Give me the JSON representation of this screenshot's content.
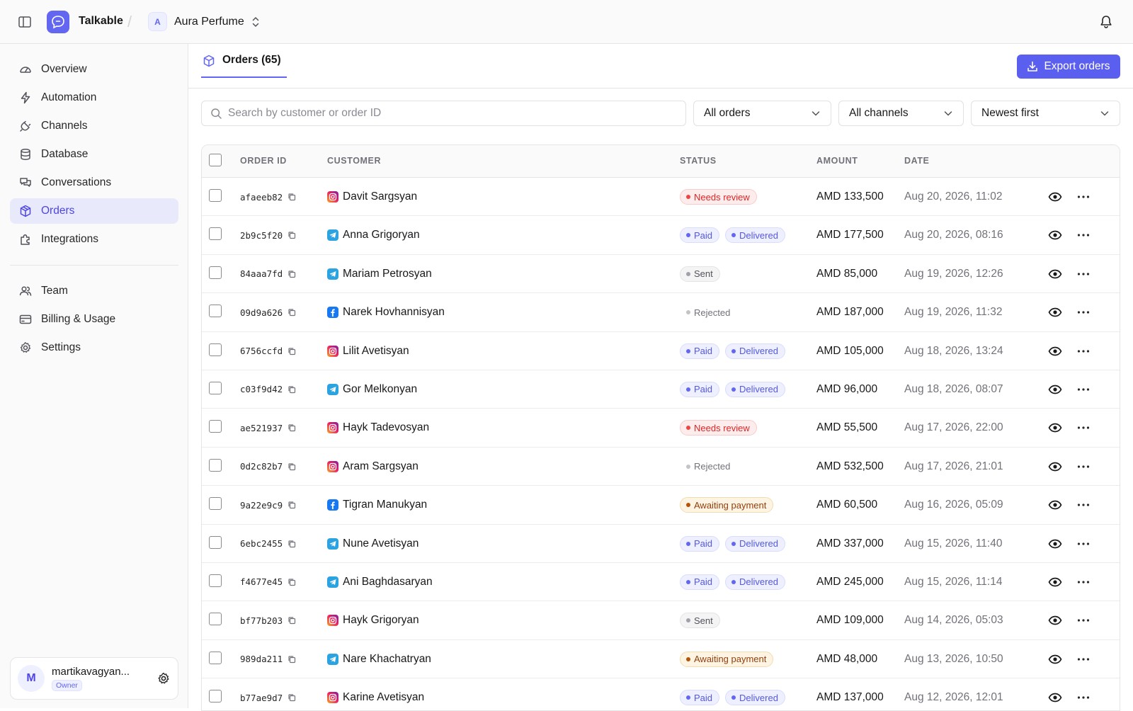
{
  "app": {
    "name": "Talkable",
    "logo_icon": "chat-link-icon"
  },
  "workspace": {
    "initial": "A",
    "name": "Aura Perfume"
  },
  "sidebar": {
    "items": [
      {
        "label": "Overview",
        "icon": "gauge-icon"
      },
      {
        "label": "Automation",
        "icon": "lightning-icon"
      },
      {
        "label": "Channels",
        "icon": "plug-icon"
      },
      {
        "label": "Database",
        "icon": "database-icon"
      },
      {
        "label": "Conversations",
        "icon": "chat-bubbles-icon"
      },
      {
        "label": "Orders",
        "icon": "package-icon",
        "active": true
      },
      {
        "label": "Integrations",
        "icon": "puzzle-icon"
      }
    ],
    "secondary": [
      {
        "label": "Team",
        "icon": "users-icon"
      },
      {
        "label": "Billing & Usage",
        "icon": "credit-card-icon"
      },
      {
        "label": "Settings",
        "icon": "gear-icon"
      }
    ],
    "user": {
      "initial": "M",
      "email": "martikavagyan...",
      "role": "Owner"
    }
  },
  "main": {
    "tab": {
      "label": "Orders (65)"
    },
    "export_label": "Export orders",
    "search": {
      "placeholder": "Search by customer or order ID",
      "value": ""
    },
    "filters": {
      "status": "All orders",
      "channel": "All channels",
      "sort": "Newest first"
    },
    "columns": [
      "ORDER ID",
      "CUSTOMER",
      "STATUS",
      "AMOUNT",
      "DATE"
    ],
    "orders": [
      {
        "id": "afaeeb82",
        "customer": "Davit Sargsyan",
        "channel": "instagram",
        "statuses": [
          {
            "label": "Needs review",
            "kind": "review"
          }
        ],
        "amount": "AMD 133,500",
        "date": "Aug 20, 2026, 11:02"
      },
      {
        "id": "2b9c5f20",
        "customer": "Anna Grigoryan",
        "channel": "telegram",
        "statuses": [
          {
            "label": "Paid",
            "kind": "paid"
          },
          {
            "label": "Delivered",
            "kind": "delivered"
          }
        ],
        "amount": "AMD 177,500",
        "date": "Aug 20, 2026, 08:16"
      },
      {
        "id": "84aaa7fd",
        "customer": "Mariam Petrosyan",
        "channel": "telegram",
        "statuses": [
          {
            "label": "Sent",
            "kind": "sent"
          }
        ],
        "amount": "AMD 85,000",
        "date": "Aug 19, 2026, 12:26"
      },
      {
        "id": "09d9a626",
        "customer": "Narek Hovhannisyan",
        "channel": "facebook",
        "statuses": [
          {
            "label": "Rejected",
            "kind": "rejected"
          }
        ],
        "amount": "AMD 187,000",
        "date": "Aug 19, 2026, 11:32"
      },
      {
        "id": "6756ccfd",
        "customer": "Lilit Avetisyan",
        "channel": "instagram",
        "statuses": [
          {
            "label": "Paid",
            "kind": "paid"
          },
          {
            "label": "Delivered",
            "kind": "delivered"
          }
        ],
        "amount": "AMD 105,000",
        "date": "Aug 18, 2026, 13:24"
      },
      {
        "id": "c03f9d42",
        "customer": "Gor Melkonyan",
        "channel": "telegram",
        "statuses": [
          {
            "label": "Paid",
            "kind": "paid"
          },
          {
            "label": "Delivered",
            "kind": "delivered"
          }
        ],
        "amount": "AMD 96,000",
        "date": "Aug 18, 2026, 08:07"
      },
      {
        "id": "ae521937",
        "customer": "Hayk Tadevosyan",
        "channel": "instagram",
        "statuses": [
          {
            "label": "Needs review",
            "kind": "review"
          }
        ],
        "amount": "AMD 55,500",
        "date": "Aug 17, 2026, 22:00"
      },
      {
        "id": "0d2c82b7",
        "customer": "Aram Sargsyan",
        "channel": "instagram",
        "statuses": [
          {
            "label": "Rejected",
            "kind": "rejected"
          }
        ],
        "amount": "AMD 532,500",
        "date": "Aug 17, 2026, 21:01"
      },
      {
        "id": "9a22e9c9",
        "customer": "Tigran Manukyan",
        "channel": "facebook",
        "statuses": [
          {
            "label": "Awaiting payment",
            "kind": "awaiting"
          }
        ],
        "amount": "AMD 60,500",
        "date": "Aug 16, 2026, 05:09"
      },
      {
        "id": "6ebc2455",
        "customer": "Nune Avetisyan",
        "channel": "telegram",
        "statuses": [
          {
            "label": "Paid",
            "kind": "paid"
          },
          {
            "label": "Delivered",
            "kind": "delivered"
          }
        ],
        "amount": "AMD 337,000",
        "date": "Aug 15, 2026, 11:40"
      },
      {
        "id": "f4677e45",
        "customer": "Ani Baghdasaryan",
        "channel": "telegram",
        "statuses": [
          {
            "label": "Paid",
            "kind": "paid"
          },
          {
            "label": "Delivered",
            "kind": "delivered"
          }
        ],
        "amount": "AMD 245,000",
        "date": "Aug 15, 2026, 11:14"
      },
      {
        "id": "bf77b203",
        "customer": "Hayk Grigoryan",
        "channel": "instagram",
        "statuses": [
          {
            "label": "Sent",
            "kind": "sent"
          }
        ],
        "amount": "AMD 109,000",
        "date": "Aug 14, 2026, 05:03"
      },
      {
        "id": "989da211",
        "customer": "Nare Khachatryan",
        "channel": "telegram",
        "statuses": [
          {
            "label": "Awaiting payment",
            "kind": "awaiting"
          }
        ],
        "amount": "AMD 48,000",
        "date": "Aug 13, 2026, 10:50"
      },
      {
        "id": "b77ae9d7",
        "customer": "Karine Avetisyan",
        "channel": "instagram",
        "statuses": [
          {
            "label": "Paid",
            "kind": "paid"
          },
          {
            "label": "Delivered",
            "kind": "delivered"
          }
        ],
        "amount": "AMD 137,000",
        "date": "Aug 12, 2026, 12:01"
      }
    ]
  },
  "colors": {
    "accent": "#6366f1",
    "needs_review": "#dc2626",
    "awaiting": "#92400e"
  }
}
